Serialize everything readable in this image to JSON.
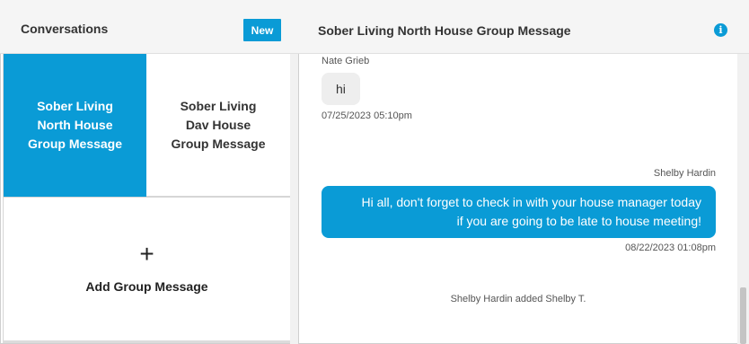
{
  "left_panel": {
    "title": "Conversations",
    "new_button": "New",
    "conversations": [
      {
        "label": "Sober Living North House Group Message",
        "lines": [
          "Sober Living",
          "North House",
          "Group Message"
        ],
        "selected": true
      },
      {
        "label": "Sober Living Dav House Group Message",
        "lines": [
          "Sober Living",
          "Dav House",
          "Group Message"
        ],
        "selected": false
      }
    ],
    "add_tile": {
      "icon": "plus-icon",
      "label": "Add Group Message"
    }
  },
  "right_panel": {
    "title": "Sober Living North House Group Message",
    "info_icon": "info-icon",
    "messages": [
      {
        "sender": "Nate Grieb",
        "text": "hi",
        "timestamp": "07/25/2023 05:10pm",
        "direction": "incoming"
      },
      {
        "sender": "Shelby Hardin",
        "lines": [
          "Hi all, don't forget to check in with your house manager today",
          "if you are going to be late to house meeting!"
        ],
        "timestamp": "08/22/2023 01:08pm",
        "direction": "outgoing"
      }
    ],
    "system_note": "Shelby Hardin added Shelby T."
  },
  "colors": {
    "accent": "#0a9bd6",
    "header_bg": "#f5f5f5",
    "incoming_bubble": "#eeeeee"
  }
}
